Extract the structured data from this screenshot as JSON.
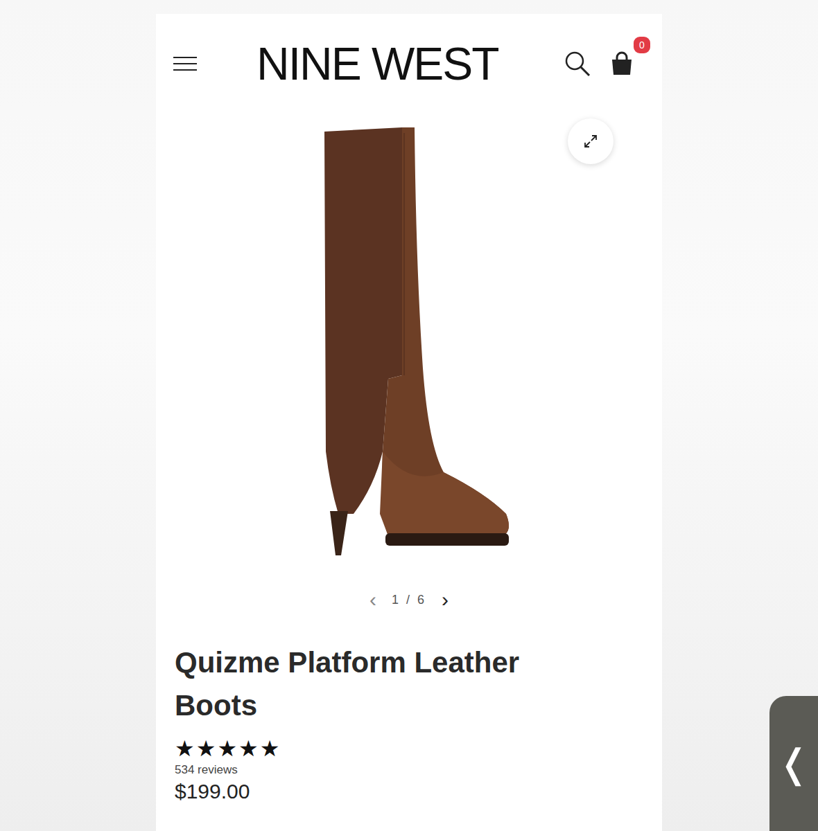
{
  "header": {
    "logo": "NINE WEST",
    "cart_badge": "0"
  },
  "gallery": {
    "prev": "‹",
    "counter": "1 / 6",
    "next": "›"
  },
  "product": {
    "title": "Quizme Platform Leather Boots",
    "stars": 5,
    "reviews": "534 reviews",
    "price": "$199.00"
  },
  "edge_tab": {
    "glyph": "❬"
  }
}
